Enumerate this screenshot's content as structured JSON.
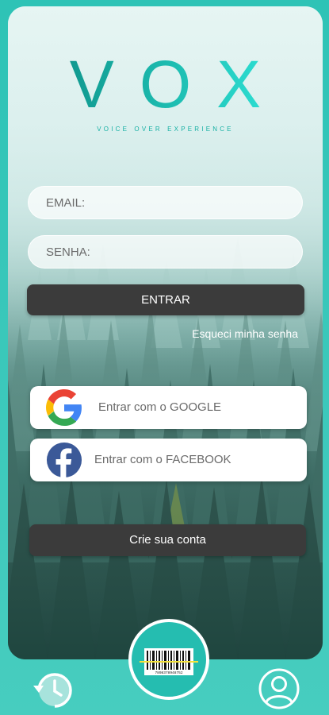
{
  "logo": {
    "title": "VOX",
    "tagline": "VOICE OVER EXPERIENCE"
  },
  "login": {
    "email_placeholder": "EMAIL:",
    "password_placeholder": "SENHA:",
    "submit_label": "ENTRAR",
    "forgot_label": "Esqueci minha senha"
  },
  "social": {
    "google_label": "Entrar com o GOOGLE",
    "facebook_label": "Entrar com o FACEBOOK"
  },
  "signup": {
    "label": "Crie sua conta"
  },
  "bottom_nav": {
    "history_icon": "history-icon",
    "scan_icon": "barcode-scan-icon",
    "profile_icon": "user-profile-icon",
    "barcode_number": "7898378948752"
  },
  "colors": {
    "frame": "#3dc7bb",
    "accent": "#16a89d",
    "button_dark": "#3b3b3b",
    "facebook_blue": "#3b5998"
  }
}
